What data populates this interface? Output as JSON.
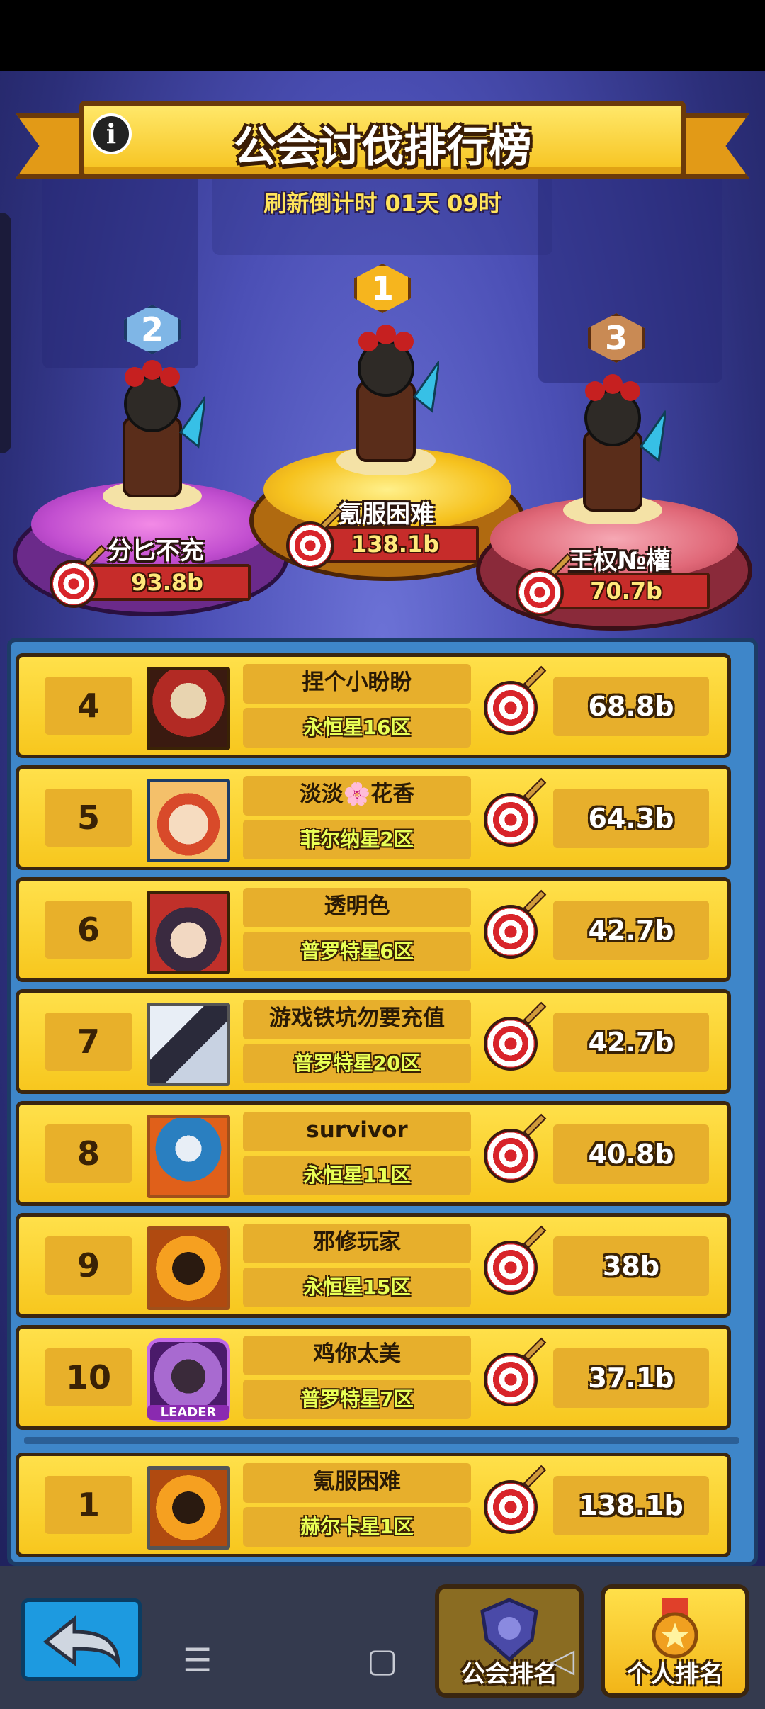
{
  "header": {
    "title": "公会讨伐排行榜",
    "info_icon": "info-icon",
    "countdown": "刷新倒计时 01天 09时"
  },
  "podium": [
    {
      "rank": "1",
      "name": "氪服困难",
      "score": "138.1b",
      "badge_color": "#f6b51e"
    },
    {
      "rank": "2",
      "name": "分匕不充",
      "score": "93.8b",
      "badge_color": "#7fb6e6"
    },
    {
      "rank": "3",
      "name": "王权№權",
      "score": "70.7b",
      "badge_color": "#c98a54"
    }
  ],
  "rankings": [
    {
      "rank": "4",
      "name": "捏个小盼盼",
      "server": "永恒星16区",
      "score": "68.8b",
      "avatar_color": "#b22a24"
    },
    {
      "rank": "5",
      "name": "淡淡🌸花香",
      "server": "菲尔纳星2区",
      "score": "64.3b",
      "avatar_color": "#e7c6a0"
    },
    {
      "rank": "6",
      "name": "透明色",
      "server": "普罗特星6区",
      "score": "42.7b",
      "avatar_color": "#c0302a"
    },
    {
      "rank": "7",
      "name": "游戏铁坑勿要充值",
      "server": "普罗特星20区",
      "score": "42.7b",
      "avatar_color": "#c8d2e2"
    },
    {
      "rank": "8",
      "name": "survivor",
      "server": "永恒星11区",
      "score": "40.8b",
      "avatar_color": "#2a7fc0"
    },
    {
      "rank": "9",
      "name": "邪修玩家",
      "server": "永恒星15区",
      "score": "38b",
      "avatar_color": "#e07a10"
    },
    {
      "rank": "10",
      "name": "鸡你太美",
      "server": "普罗特星7区",
      "score": "37.1b",
      "avatar_color": "#6a2a8a"
    }
  ],
  "my_guild": {
    "rank": "1",
    "name": "氪服困难",
    "server": "赫尔卡星1区",
    "score": "138.1b",
    "avatar_color": "#e07a10"
  },
  "footer": {
    "back_icon": "back-arrow-icon",
    "guild_tab_label": "公会排名",
    "personal_tab_label": "个人排名",
    "leader_badge": "LEADER"
  },
  "colors": {
    "accent_gold": "#f7c71e",
    "panel_blue": "#3e86c9",
    "score_red": "#c62c2a"
  }
}
